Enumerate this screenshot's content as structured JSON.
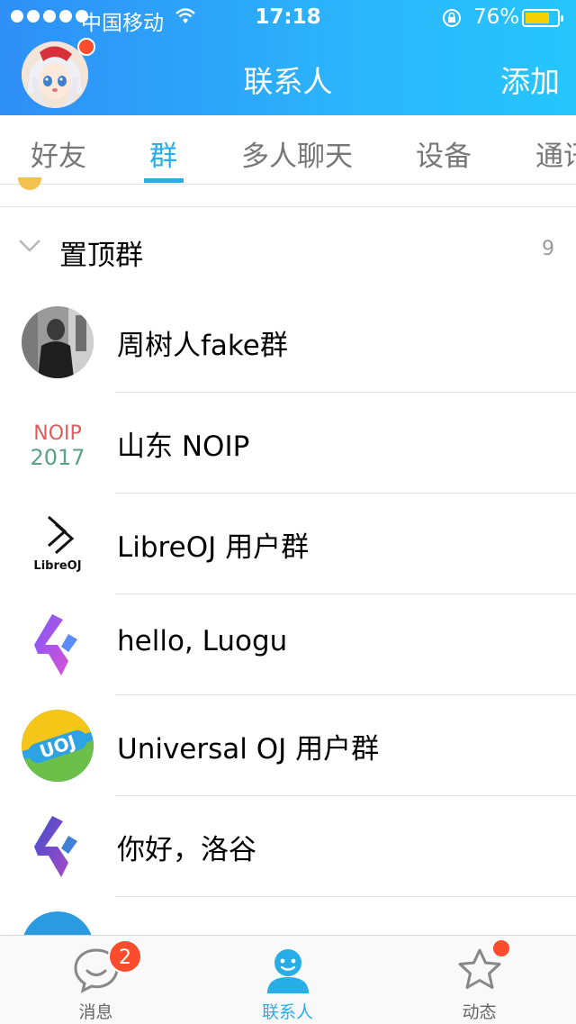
{
  "status_bar": {
    "carrier": "中国移动",
    "time": "17:18",
    "battery_percent": "76%",
    "battery_level": 0.76,
    "signal_bars": 5
  },
  "header": {
    "title": "联系人",
    "add_label": "添加",
    "avatar_has_badge": true
  },
  "tabs": [
    {
      "label": "好友",
      "active": false
    },
    {
      "label": "群",
      "active": true
    },
    {
      "label": "多人聊天",
      "active": false
    },
    {
      "label": "设备",
      "active": false
    },
    {
      "label": "通讯录",
      "active": false
    }
  ],
  "section": {
    "title": "置顶群",
    "count": "9",
    "expanded": true
  },
  "groups": [
    {
      "name": "周树人fake群",
      "avatar": "photo-avatar"
    },
    {
      "name": "山东 NOIP",
      "avatar": "noip-2017-logo",
      "logo_text": [
        "NOIP",
        "2017"
      ]
    },
    {
      "name": "LibreOJ 用户群",
      "avatar": "libreoj-logo",
      "logo_text": "LibreOJ"
    },
    {
      "name": "hello, Luogu",
      "avatar": "luogu-logo"
    },
    {
      "name": "Universal OJ 用户群",
      "avatar": "uoj-logo",
      "logo_text": "UOJ"
    },
    {
      "name": "你好，洛谷",
      "avatar": "luogu-logo"
    }
  ],
  "bottom_nav": [
    {
      "label": "消息",
      "icon": "chat-bubble-icon",
      "badge": "2",
      "active": false
    },
    {
      "label": "联系人",
      "icon": "contacts-person-icon",
      "active": true
    },
    {
      "label": "动态",
      "icon": "star-icon",
      "has_dot": true,
      "active": false
    }
  ],
  "colors": {
    "header_start": "#2f8ff7",
    "header_end": "#26c6fc",
    "accent": "#27aee8",
    "badge": "#fb4d2d",
    "battery": "#f7d000"
  }
}
